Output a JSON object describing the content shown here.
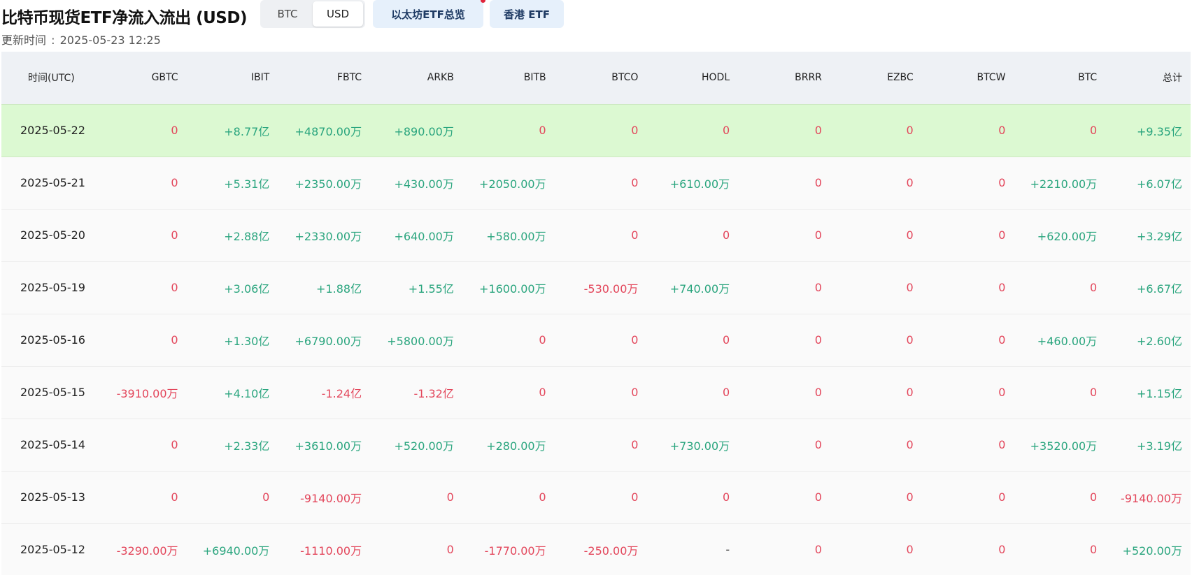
{
  "header": {
    "title": "比特币现货ETF净流入流出 (USD)",
    "updated_label": "更新时间",
    "updated_value": "2025-05-23 12:25"
  },
  "toggle": {
    "options": [
      "BTC",
      "USD"
    ],
    "selected": "USD"
  },
  "links": {
    "eth": "以太坊ETF总览",
    "hk": "香港 ETF"
  },
  "colors": {
    "positive": "#2aa57e",
    "negative": "#e3465b",
    "highlight_row": "#dcf9d2",
    "header_bg": "#eef1f5",
    "link_bg": "#e6f0fb"
  },
  "table": {
    "columns": [
      "时间(UTC)",
      "GBTC",
      "IBIT",
      "FBTC",
      "ARKB",
      "BITB",
      "BTCO",
      "HODL",
      "BRRR",
      "EZBC",
      "BTCW",
      "BTC",
      "总计"
    ],
    "rows": [
      {
        "date": "2025-05-22",
        "highlight": true,
        "cells": [
          "0",
          "+8.77亿",
          "+4870.00万",
          "+890.00万",
          "0",
          "0",
          "0",
          "0",
          "0",
          "0",
          "0",
          "+9.35亿"
        ]
      },
      {
        "date": "2025-05-21",
        "highlight": false,
        "cells": [
          "0",
          "+5.31亿",
          "+2350.00万",
          "+430.00万",
          "+2050.00万",
          "0",
          "+610.00万",
          "0",
          "0",
          "0",
          "+2210.00万",
          "+6.07亿"
        ]
      },
      {
        "date": "2025-05-20",
        "highlight": false,
        "cells": [
          "0",
          "+2.88亿",
          "+2330.00万",
          "+640.00万",
          "+580.00万",
          "0",
          "0",
          "0",
          "0",
          "0",
          "+620.00万",
          "+3.29亿"
        ]
      },
      {
        "date": "2025-05-19",
        "highlight": false,
        "cells": [
          "0",
          "+3.06亿",
          "+1.88亿",
          "+1.55亿",
          "+1600.00万",
          "-530.00万",
          "+740.00万",
          "0",
          "0",
          "0",
          "0",
          "+6.67亿"
        ]
      },
      {
        "date": "2025-05-16",
        "highlight": false,
        "cells": [
          "0",
          "+1.30亿",
          "+6790.00万",
          "+5800.00万",
          "0",
          "0",
          "0",
          "0",
          "0",
          "0",
          "+460.00万",
          "+2.60亿"
        ]
      },
      {
        "date": "2025-05-15",
        "highlight": false,
        "cells": [
          "-3910.00万",
          "+4.10亿",
          "-1.24亿",
          "-1.32亿",
          "0",
          "0",
          "0",
          "0",
          "0",
          "0",
          "0",
          "+1.15亿"
        ]
      },
      {
        "date": "2025-05-14",
        "highlight": false,
        "cells": [
          "0",
          "+2.33亿",
          "+3610.00万",
          "+520.00万",
          "+280.00万",
          "0",
          "+730.00万",
          "0",
          "0",
          "0",
          "+3520.00万",
          "+3.19亿"
        ]
      },
      {
        "date": "2025-05-13",
        "highlight": false,
        "cells": [
          "0",
          "0",
          "-9140.00万",
          "0",
          "0",
          "0",
          "0",
          "0",
          "0",
          "0",
          "0",
          "-9140.00万"
        ]
      },
      {
        "date": "2025-05-12",
        "highlight": false,
        "cells": [
          "-3290.00万",
          "+6940.00万",
          "-1110.00万",
          "0",
          "-1770.00万",
          "-250.00万",
          "-",
          "0",
          "0",
          "0",
          "0",
          "+520.00万"
        ]
      }
    ]
  }
}
